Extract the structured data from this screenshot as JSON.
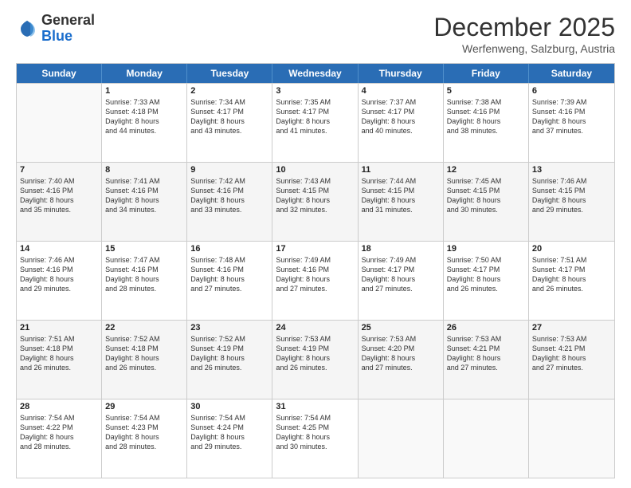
{
  "logo": {
    "line1": "General",
    "line2": "Blue"
  },
  "header": {
    "month": "December 2025",
    "location": "Werfenweng, Salzburg, Austria"
  },
  "weekdays": [
    "Sunday",
    "Monday",
    "Tuesday",
    "Wednesday",
    "Thursday",
    "Friday",
    "Saturday"
  ],
  "weeks": [
    [
      {
        "day": "",
        "info": ""
      },
      {
        "day": "1",
        "info": "Sunrise: 7:33 AM\nSunset: 4:18 PM\nDaylight: 8 hours\nand 44 minutes."
      },
      {
        "day": "2",
        "info": "Sunrise: 7:34 AM\nSunset: 4:17 PM\nDaylight: 8 hours\nand 43 minutes."
      },
      {
        "day": "3",
        "info": "Sunrise: 7:35 AM\nSunset: 4:17 PM\nDaylight: 8 hours\nand 41 minutes."
      },
      {
        "day": "4",
        "info": "Sunrise: 7:37 AM\nSunset: 4:17 PM\nDaylight: 8 hours\nand 40 minutes."
      },
      {
        "day": "5",
        "info": "Sunrise: 7:38 AM\nSunset: 4:16 PM\nDaylight: 8 hours\nand 38 minutes."
      },
      {
        "day": "6",
        "info": "Sunrise: 7:39 AM\nSunset: 4:16 PM\nDaylight: 8 hours\nand 37 minutes."
      }
    ],
    [
      {
        "day": "7",
        "info": "Sunrise: 7:40 AM\nSunset: 4:16 PM\nDaylight: 8 hours\nand 35 minutes."
      },
      {
        "day": "8",
        "info": "Sunrise: 7:41 AM\nSunset: 4:16 PM\nDaylight: 8 hours\nand 34 minutes."
      },
      {
        "day": "9",
        "info": "Sunrise: 7:42 AM\nSunset: 4:16 PM\nDaylight: 8 hours\nand 33 minutes."
      },
      {
        "day": "10",
        "info": "Sunrise: 7:43 AM\nSunset: 4:15 PM\nDaylight: 8 hours\nand 32 minutes."
      },
      {
        "day": "11",
        "info": "Sunrise: 7:44 AM\nSunset: 4:15 PM\nDaylight: 8 hours\nand 31 minutes."
      },
      {
        "day": "12",
        "info": "Sunrise: 7:45 AM\nSunset: 4:15 PM\nDaylight: 8 hours\nand 30 minutes."
      },
      {
        "day": "13",
        "info": "Sunrise: 7:46 AM\nSunset: 4:15 PM\nDaylight: 8 hours\nand 29 minutes."
      }
    ],
    [
      {
        "day": "14",
        "info": "Sunrise: 7:46 AM\nSunset: 4:16 PM\nDaylight: 8 hours\nand 29 minutes."
      },
      {
        "day": "15",
        "info": "Sunrise: 7:47 AM\nSunset: 4:16 PM\nDaylight: 8 hours\nand 28 minutes."
      },
      {
        "day": "16",
        "info": "Sunrise: 7:48 AM\nSunset: 4:16 PM\nDaylight: 8 hours\nand 27 minutes."
      },
      {
        "day": "17",
        "info": "Sunrise: 7:49 AM\nSunset: 4:16 PM\nDaylight: 8 hours\nand 27 minutes."
      },
      {
        "day": "18",
        "info": "Sunrise: 7:49 AM\nSunset: 4:17 PM\nDaylight: 8 hours\nand 27 minutes."
      },
      {
        "day": "19",
        "info": "Sunrise: 7:50 AM\nSunset: 4:17 PM\nDaylight: 8 hours\nand 26 minutes."
      },
      {
        "day": "20",
        "info": "Sunrise: 7:51 AM\nSunset: 4:17 PM\nDaylight: 8 hours\nand 26 minutes."
      }
    ],
    [
      {
        "day": "21",
        "info": "Sunrise: 7:51 AM\nSunset: 4:18 PM\nDaylight: 8 hours\nand 26 minutes."
      },
      {
        "day": "22",
        "info": "Sunrise: 7:52 AM\nSunset: 4:18 PM\nDaylight: 8 hours\nand 26 minutes."
      },
      {
        "day": "23",
        "info": "Sunrise: 7:52 AM\nSunset: 4:19 PM\nDaylight: 8 hours\nand 26 minutes."
      },
      {
        "day": "24",
        "info": "Sunrise: 7:53 AM\nSunset: 4:19 PM\nDaylight: 8 hours\nand 26 minutes."
      },
      {
        "day": "25",
        "info": "Sunrise: 7:53 AM\nSunset: 4:20 PM\nDaylight: 8 hours\nand 27 minutes."
      },
      {
        "day": "26",
        "info": "Sunrise: 7:53 AM\nSunset: 4:21 PM\nDaylight: 8 hours\nand 27 minutes."
      },
      {
        "day": "27",
        "info": "Sunrise: 7:53 AM\nSunset: 4:21 PM\nDaylight: 8 hours\nand 27 minutes."
      }
    ],
    [
      {
        "day": "28",
        "info": "Sunrise: 7:54 AM\nSunset: 4:22 PM\nDaylight: 8 hours\nand 28 minutes."
      },
      {
        "day": "29",
        "info": "Sunrise: 7:54 AM\nSunset: 4:23 PM\nDaylight: 8 hours\nand 28 minutes."
      },
      {
        "day": "30",
        "info": "Sunrise: 7:54 AM\nSunset: 4:24 PM\nDaylight: 8 hours\nand 29 minutes."
      },
      {
        "day": "31",
        "info": "Sunrise: 7:54 AM\nSunset: 4:25 PM\nDaylight: 8 hours\nand 30 minutes."
      },
      {
        "day": "",
        "info": ""
      },
      {
        "day": "",
        "info": ""
      },
      {
        "day": "",
        "info": ""
      }
    ]
  ]
}
